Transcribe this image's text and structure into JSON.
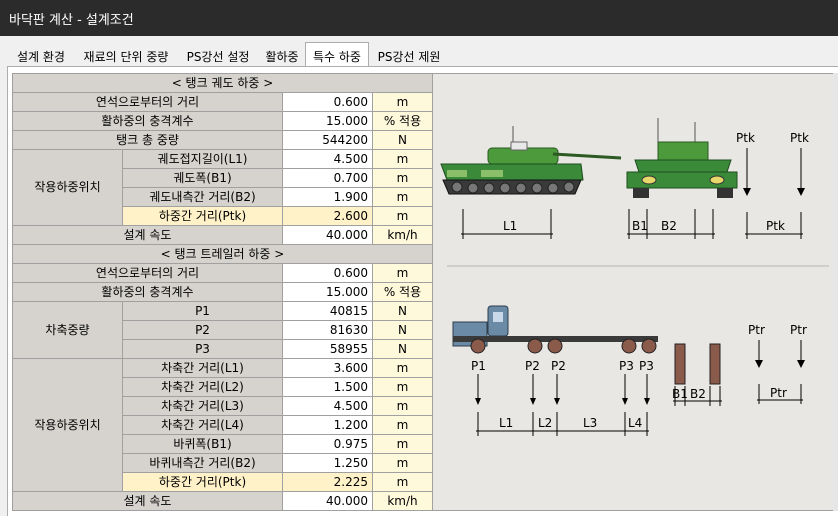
{
  "window": {
    "title": "바닥판 계산 - 설계조건"
  },
  "tabs": [
    {
      "label": "설계 환경"
    },
    {
      "label": "재료의 단위 중량"
    },
    {
      "label": "PS강선 설정"
    },
    {
      "label": "활하중"
    },
    {
      "label": "특수 하중"
    },
    {
      "label": "PS강선 제원"
    }
  ],
  "tank_track": {
    "header": "< 탱크 궤도 하중 >",
    "rows": [
      {
        "label": "연석으로부터의 거리",
        "value": "0.600",
        "unit": "m"
      },
      {
        "label": "활하중의 충격계수",
        "value": "15.000",
        "unit": "% 적용"
      },
      {
        "label": "탱크 총 중량",
        "value": "544200",
        "unit": "N"
      }
    ],
    "group_label": "작용하중위치",
    "group_rows": [
      {
        "label": "궤도접지길이(L1)",
        "value": "4.500",
        "unit": "m"
      },
      {
        "label": "궤도폭(B1)",
        "value": "0.700",
        "unit": "m"
      },
      {
        "label": "궤도내측간 거리(B2)",
        "value": "1.900",
        "unit": "m"
      },
      {
        "label": "하중간 거리(Ptk)",
        "value": "2.600",
        "unit": "m"
      }
    ],
    "speed": {
      "label": "설계 속도",
      "value": "40.000",
      "unit": "km/h"
    }
  },
  "tank_trailer": {
    "header": "< 탱크 트레일러 하중 >",
    "rows": [
      {
        "label": "연석으로부터의 거리",
        "value": "0.600",
        "unit": "m"
      },
      {
        "label": "활하중의 충격계수",
        "value": "15.000",
        "unit": "% 적용"
      }
    ],
    "axle_group_label": "차축중량",
    "axle_rows": [
      {
        "label": "P1",
        "value": "40815",
        "unit": "N"
      },
      {
        "label": "P2",
        "value": "81630",
        "unit": "N"
      },
      {
        "label": "P3",
        "value": "58955",
        "unit": "N"
      }
    ],
    "group_label": "작용하중위치",
    "group_rows": [
      {
        "label": "차축간 거리(L1)",
        "value": "3.600",
        "unit": "m"
      },
      {
        "label": "차축간 거리(L2)",
        "value": "1.500",
        "unit": "m"
      },
      {
        "label": "차축간 거리(L3)",
        "value": "4.500",
        "unit": "m"
      },
      {
        "label": "차축간 거리(L4)",
        "value": "1.200",
        "unit": "m"
      },
      {
        "label": "바퀴폭(B1)",
        "value": "0.975",
        "unit": "m"
      },
      {
        "label": "바퀴내측간 거리(B2)",
        "value": "1.250",
        "unit": "m"
      },
      {
        "label": "하중간 거리(Ptk)",
        "value": "2.225",
        "unit": "m"
      }
    ],
    "speed": {
      "label": "설계 속도",
      "value": "40.000",
      "unit": "km/h"
    }
  },
  "diagram": {
    "tank_dims": {
      "l1": "L1",
      "b1": "B1",
      "b2": "B2",
      "ptk": "Ptk"
    },
    "trailer_loads": {
      "p1": "P1",
      "p2": "P2",
      "p3": "P3",
      "ptr": "Ptr"
    },
    "trailer_dims": {
      "l1": "L1",
      "l2": "L2",
      "l3": "L3",
      "l4": "L4",
      "b1": "B1",
      "b2": "B2",
      "ptr": "Ptr"
    }
  },
  "colors": {
    "label_bg": "#d6d3ce",
    "unit_bg": "#fff9dc",
    "highlight": "#fff1c8",
    "tank_green": "#3a8a3a",
    "truck_blue": "#6a8aa6"
  }
}
